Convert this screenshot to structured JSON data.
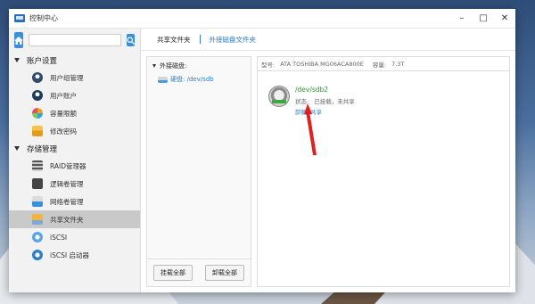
{
  "window": {
    "title": "控制中心"
  },
  "sidebar": {
    "search": {
      "placeholder": ""
    },
    "groups": [
      {
        "label": "账户设置",
        "items": [
          {
            "label": "用户组管理",
            "icon": "user-group-icon"
          },
          {
            "label": "用户账户",
            "icon": "user-account-icon"
          },
          {
            "label": "容量限额",
            "icon": "quota-pie-icon"
          },
          {
            "label": "修改密码",
            "icon": "lock-icon"
          }
        ]
      },
      {
        "label": "存储管理",
        "items": [
          {
            "label": "RAID管理器",
            "icon": "raid-icon"
          },
          {
            "label": "逻辑卷管理",
            "icon": "logical-volume-icon"
          },
          {
            "label": "网络卷管理",
            "icon": "network-volume-icon"
          },
          {
            "label": "共享文件夹",
            "icon": "shared-folder-icon",
            "active": true
          },
          {
            "label": "iSCSI",
            "icon": "iscsi-icon"
          },
          {
            "label": "iSCSI 启动器",
            "icon": "iscsi-initiator-icon"
          }
        ]
      }
    ]
  },
  "tabs": [
    {
      "label": "共享文件夹"
    },
    {
      "label": "外接磁盘文件夹"
    }
  ],
  "disk_panel": {
    "header": "外接磁盘:",
    "disk_label": "硬盘: /dev/sdb",
    "mount_all": "挂载全部",
    "unmount_all": "卸载全部"
  },
  "detail": {
    "model_label": "型号:",
    "model_value": "ATA TOSHIBA MG06ACA800E",
    "capacity_label": "容量:",
    "capacity_value": "7.3T",
    "partition": {
      "name": "/dev/sdb2",
      "status_label": "状态:",
      "status_value": "已挂载，未共享",
      "action_unmount": "卸载",
      "action_share": "共享"
    }
  },
  "colors": {
    "accent": "#2b7fd0",
    "active_row": "#c9c9c9",
    "partition_name": "#2d9a2d",
    "annotation_arrow": "#e02020"
  }
}
